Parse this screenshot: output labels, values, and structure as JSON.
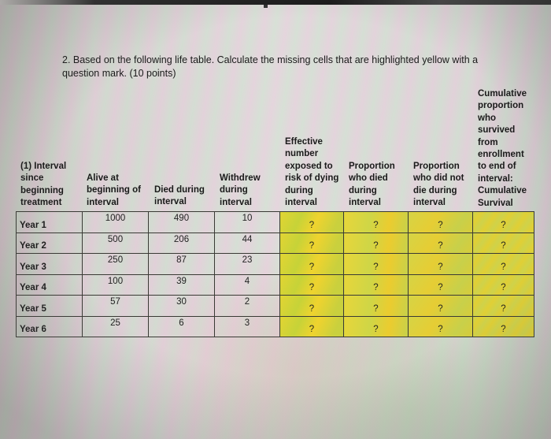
{
  "question": {
    "text": "2. Based on the following life table. Calculate the missing cells that are highlighted yellow with a question mark.  (10 points)"
  },
  "table": {
    "headers": [
      "(1) Interval since beginning treatment",
      "Alive at beginning of interval",
      "Died during interval",
      "Withdrew during interval",
      "Effective number exposed to risk of dying during interval",
      "Proportion who died during interval",
      "Proportion who did not die during interval",
      "Cumulative proportion who survived from enrollment to end of interval: Cumulative Survival"
    ],
    "header_lines": [
      [
        "(1) Interval",
        "since",
        "beginning",
        "treatment"
      ],
      [
        "Alive at",
        "beginning of",
        "interval"
      ],
      [
        "Died during",
        "interval"
      ],
      [
        "Withdrew",
        "during",
        "interval"
      ],
      [
        "Effective",
        "number",
        "exposed to",
        "risk of dying",
        "during",
        "interval"
      ],
      [
        "Proportion",
        "who died",
        "during",
        "interval"
      ],
      [
        "Proportion",
        "who did not",
        "die during",
        "interval"
      ],
      [
        "Cumulative",
        "proportion",
        "who",
        "survived",
        "from",
        "enrollment",
        "to end of",
        "interval:",
        "Cumulative",
        "Survival"
      ]
    ],
    "rows": [
      {
        "interval": "Year 1",
        "alive": "1000",
        "died": "490",
        "withdrew": "10",
        "effective": "?",
        "prop_died": "?",
        "prop_survived": "?",
        "cumulative": "?"
      },
      {
        "interval": "Year 2",
        "alive": "500",
        "died": "206",
        "withdrew": "44",
        "effective": "?",
        "prop_died": "?",
        "prop_survived": "?",
        "cumulative": "?"
      },
      {
        "interval": "Year 3",
        "alive": "250",
        "died": "87",
        "withdrew": "23",
        "effective": "?",
        "prop_died": "?",
        "prop_survived": "?",
        "cumulative": "?"
      },
      {
        "interval": "Year 4",
        "alive": "100",
        "died": "39",
        "withdrew": "4",
        "effective": "?",
        "prop_died": "?",
        "prop_survived": "?",
        "cumulative": "?"
      },
      {
        "interval": "Year 5",
        "alive": "57",
        "died": "30",
        "withdrew": "2",
        "effective": "?",
        "prop_died": "?",
        "prop_survived": "?",
        "cumulative": "?"
      },
      {
        "interval": "Year 6",
        "alive": "25",
        "died": "6",
        "withdrew": "3",
        "effective": "?",
        "prop_died": "?",
        "prop_survived": "?",
        "cumulative": "?"
      }
    ],
    "highlight_color": "#e2d433",
    "border_color": "#3a3a35"
  }
}
